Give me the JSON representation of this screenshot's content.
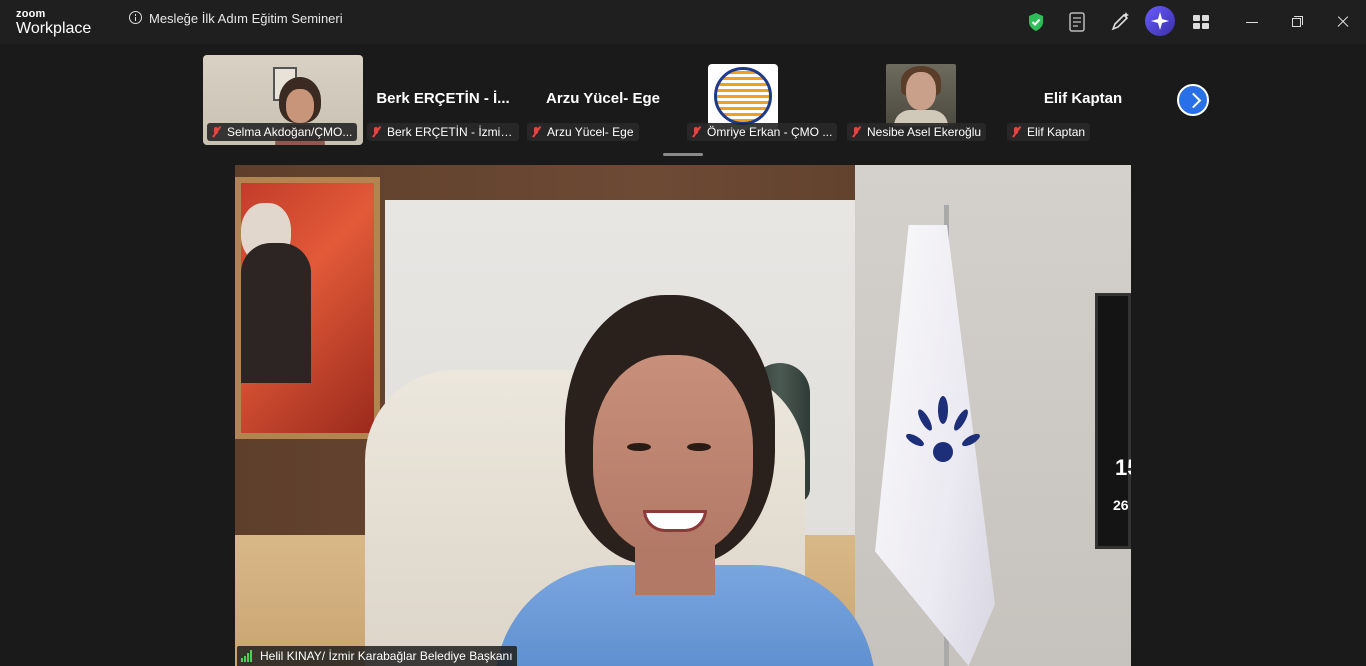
{
  "app": {
    "brand_top": "zoom",
    "brand_bottom": "Workplace"
  },
  "meeting": {
    "title": "Mesleğe İlk Adım Eğitim Semineri"
  },
  "toolbar_icons": [
    "shield-check-icon",
    "notes-icon",
    "annotate-icon",
    "ai-companion-icon",
    "apps-grid-icon"
  ],
  "window_controls": [
    "minimize",
    "restore",
    "close"
  ],
  "participants": [
    {
      "display_name": "",
      "label": "Selma Akdoğan/ÇMO...",
      "muted": true,
      "video": "camera"
    },
    {
      "display_name": "Berk ERÇETİN - İ...",
      "label": "Berk ERÇETİN - İzmir ...",
      "muted": true,
      "video": "off"
    },
    {
      "display_name": "Arzu Yücel- Ege",
      "label": "Arzu Yücel- Ege",
      "muted": true,
      "video": "off"
    },
    {
      "display_name": "",
      "label": "Ömriye Erkan - ÇMO ...",
      "muted": true,
      "video": "logo"
    },
    {
      "display_name": "",
      "label": "Nesibe Asel Ekeroğlu",
      "muted": true,
      "video": "photo"
    },
    {
      "display_name": "Elif Kaptan",
      "label": "Elif Kaptan",
      "muted": true,
      "video": "off"
    }
  ],
  "main_speaker": {
    "label": "Helil KINAY/ İzmir Karabağlar Belediye Başkanı",
    "background_text": {
      "tv_line1": "15",
      "tv_line2": "26"
    }
  },
  "colors": {
    "accent": "#2970e8",
    "muted_icon": "#e5473f",
    "shield": "#2ebd59",
    "ai": "#6a5cff"
  }
}
